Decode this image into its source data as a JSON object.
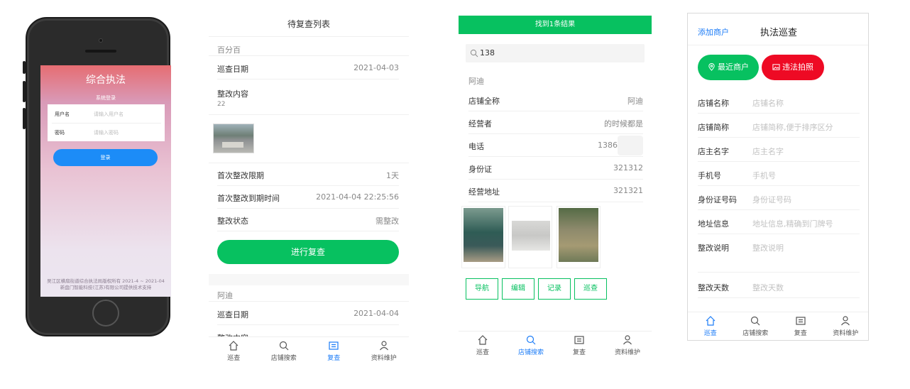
{
  "login_screen": {
    "title": "综合执法",
    "subtitle": "系统登录",
    "username_label": "用户名",
    "username_placeholder": "请输入用户名",
    "password_label": "密码",
    "password_placeholder": "请输入密码",
    "login_button": "登录",
    "footer_line1": "吴江区横扇街道综合执法局版权所有 2021-4 ~ 2021-04",
    "footer_line2": "新盘门智能科技(江苏)有限公司提供技术支持"
  },
  "review_list": {
    "title": "待复查列表",
    "record1": {
      "store": "百分百",
      "inspect_date_label": "巡查日期",
      "inspect_date": "2021-04-03",
      "content_label": "整改内容",
      "content_value": "22",
      "limit_label": "首次整改限期",
      "limit_value": "1天",
      "due_label": "首次整改到期时间",
      "due_value": "2021-04-04 22:25:56",
      "status_label": "整改状态",
      "status_value": "需整改",
      "action_button": "进行复查"
    },
    "record2": {
      "store": "阿迪",
      "inspect_date_label": "巡查日期",
      "inspect_date": "2021-04-04",
      "content_label": "整改内容"
    }
  },
  "search_result": {
    "banner": "找到1条结果",
    "query": "138",
    "store": "阿迪",
    "fields": [
      {
        "label": "店铺全称",
        "value": "阿迪"
      },
      {
        "label": "经营者",
        "value": "的时候都是"
      },
      {
        "label": "电话",
        "value": "1386"
      },
      {
        "label": "身份证",
        "value": "321312"
      },
      {
        "label": "经营地址",
        "value": "321321"
      }
    ],
    "actions": [
      "导航",
      "编辑",
      "记录",
      "巡查"
    ]
  },
  "patrol_form": {
    "add_merchant": "添加商户",
    "title": "执法巡查",
    "recent_button": "最近商户",
    "photo_button": "违法拍照",
    "fields": [
      {
        "label": "店铺名称",
        "placeholder": "店铺名称"
      },
      {
        "label": "店铺简称",
        "placeholder": "店铺简称,便于排序区分"
      },
      {
        "label": "店主名字",
        "placeholder": "店主名字"
      },
      {
        "label": "手机号",
        "placeholder": "手机号"
      },
      {
        "label": "身份证号码",
        "placeholder": "身份证号码"
      },
      {
        "label": "地址信息",
        "placeholder": "地址信息,精确到门牌号"
      },
      {
        "label": "整改说明",
        "placeholder": "整改说明"
      },
      {
        "label": "整改天数",
        "placeholder": "整改天数"
      }
    ]
  },
  "tabbar": {
    "tabs": [
      "巡查",
      "店铺搜索",
      "复查",
      "资料维护"
    ]
  },
  "colors": {
    "green": "#07c160",
    "blue": "#1c8cf7",
    "red": "#ee0a24"
  }
}
